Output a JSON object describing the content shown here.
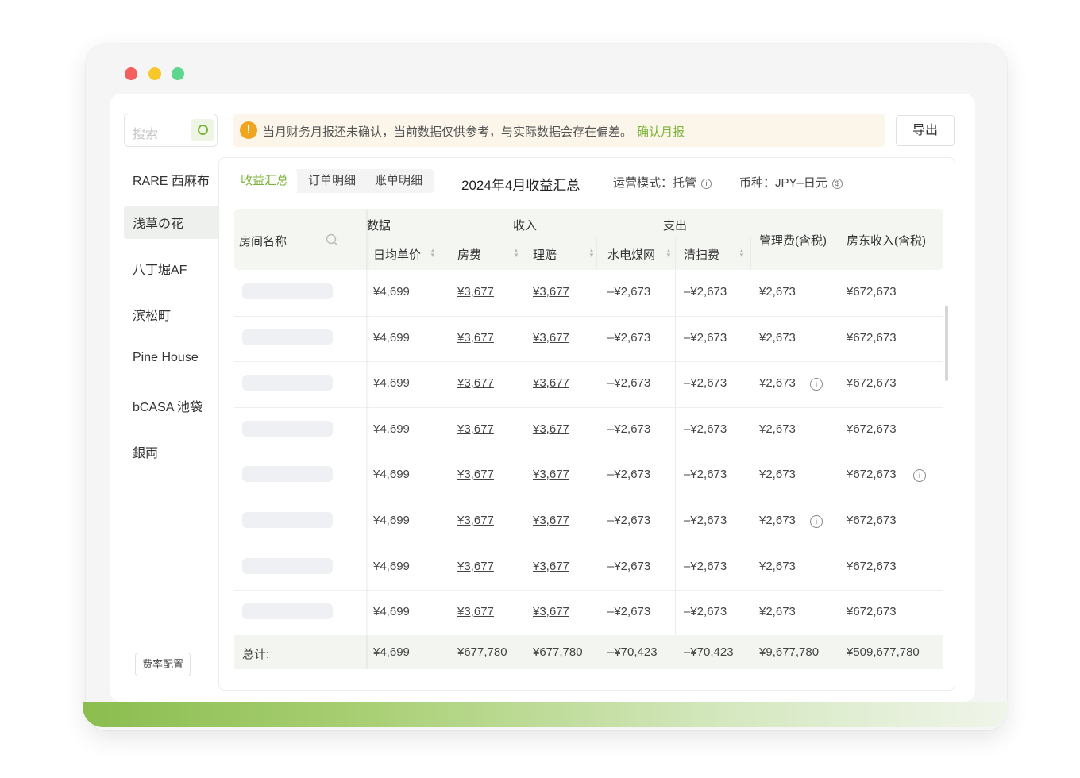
{
  "sidebar": {
    "search_placeholder": "搜索",
    "items": [
      "RARE 西麻布",
      "浅草の花",
      "八丁堀AF",
      "滨松町",
      "Pine House",
      "bCASA 池袋",
      "銀両"
    ],
    "active_index": 1,
    "fee_config_label": "费率配置"
  },
  "notice": {
    "text": "当月财务月报还未确认，当前数据仅供参考，与实际数据会存在偏差。",
    "link": "确认月报"
  },
  "toolbar": {
    "export_label": "导出"
  },
  "tabs": [
    "收益汇总",
    "订单明细",
    "账单明细"
  ],
  "active_tab": 0,
  "title": "2024年4月收益汇总",
  "mode": {
    "label": "运营模式：托管"
  },
  "currency": {
    "label": "币种：JPY–日元"
  },
  "table": {
    "group_headers": {
      "data": "数据",
      "income": "收入",
      "expense": "支出"
    },
    "columns": {
      "room": "房间名称",
      "avg_price": "日均单价",
      "room_fee": "房费",
      "claim": "理赔",
      "utilities": "水电煤网",
      "cleaning": "清扫费",
      "mgmt_fee": "管理费(含税)",
      "owner_income": "房东收入(含税)"
    },
    "rows": [
      {
        "avg_price": "¥4,699",
        "room_fee": "¥3,677",
        "claim": "¥3,677",
        "utilities": "–¥2,673",
        "cleaning": "–¥2,673",
        "mgmt_fee": "¥2,673",
        "owner_income": "¥672,673",
        "mgmt_info": false,
        "owner_info": false
      },
      {
        "avg_price": "¥4,699",
        "room_fee": "¥3,677",
        "claim": "¥3,677",
        "utilities": "–¥2,673",
        "cleaning": "–¥2,673",
        "mgmt_fee": "¥2,673",
        "owner_income": "¥672,673",
        "mgmt_info": false,
        "owner_info": false
      },
      {
        "avg_price": "¥4,699",
        "room_fee": "¥3,677",
        "claim": "¥3,677",
        "utilities": "–¥2,673",
        "cleaning": "–¥2,673",
        "mgmt_fee": "¥2,673",
        "owner_income": "¥672,673",
        "mgmt_info": true,
        "owner_info": false
      },
      {
        "avg_price": "¥4,699",
        "room_fee": "¥3,677",
        "claim": "¥3,677",
        "utilities": "–¥2,673",
        "cleaning": "–¥2,673",
        "mgmt_fee": "¥2,673",
        "owner_income": "¥672,673",
        "mgmt_info": false,
        "owner_info": false
      },
      {
        "avg_price": "¥4,699",
        "room_fee": "¥3,677",
        "claim": "¥3,677",
        "utilities": "–¥2,673",
        "cleaning": "–¥2,673",
        "mgmt_fee": "¥2,673",
        "owner_income": "¥672,673",
        "mgmt_info": false,
        "owner_info": true
      },
      {
        "avg_price": "¥4,699",
        "room_fee": "¥3,677",
        "claim": "¥3,677",
        "utilities": "–¥2,673",
        "cleaning": "–¥2,673",
        "mgmt_fee": "¥2,673",
        "owner_income": "¥672,673",
        "mgmt_info": true,
        "owner_info": false
      },
      {
        "avg_price": "¥4,699",
        "room_fee": "¥3,677",
        "claim": "¥3,677",
        "utilities": "–¥2,673",
        "cleaning": "–¥2,673",
        "mgmt_fee": "¥2,673",
        "owner_income": "¥672,673",
        "mgmt_info": false,
        "owner_info": false
      },
      {
        "avg_price": "¥4,699",
        "room_fee": "¥3,677",
        "claim": "¥3,677",
        "utilities": "–¥2,673",
        "cleaning": "–¥2,673",
        "mgmt_fee": "¥2,673",
        "owner_income": "¥672,673",
        "mgmt_info": false,
        "owner_info": false
      }
    ],
    "total": {
      "label": "总计:",
      "avg_price": "¥4,699",
      "room_fee": "¥677,780",
      "claim": "¥677,780",
      "utilities": "–¥70,423",
      "cleaning": "–¥70,423",
      "mgmt_fee": "¥9,677,780",
      "owner_income": "¥509,677,780"
    }
  },
  "colors": {
    "accent": "#7bb33a",
    "warning": "#f0a521"
  }
}
